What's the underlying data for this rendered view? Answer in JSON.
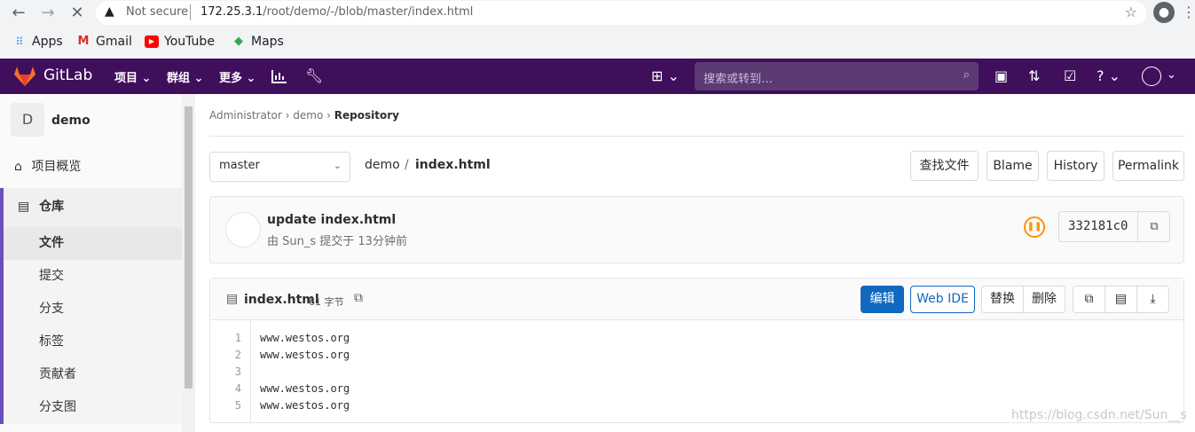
{
  "browser": {
    "not_secure": "Not secure",
    "url_host": "172.25.3.1",
    "url_path": "/root/demo/-/blob/master/index.html",
    "bookmarks": [
      {
        "label": "Apps",
        "icon": "apps-grid-icon"
      },
      {
        "label": "Gmail",
        "icon": "gmail-icon"
      },
      {
        "label": "YouTube",
        "icon": "youtube-icon"
      },
      {
        "label": "Maps",
        "icon": "maps-icon"
      }
    ]
  },
  "gitlab": {
    "logo_text": "GitLab",
    "nav": [
      "项目",
      "群组",
      "更多"
    ],
    "search_placeholder": "搜索或转到…",
    "colors": {
      "header": "#3f0f5c",
      "primary": "#1068bf",
      "pipeline": "#fc9403"
    }
  },
  "sidebar": {
    "avatar_letter": "D",
    "project_name": "demo",
    "overview": "项目概览",
    "repository": "仓库",
    "items": [
      "文件",
      "提交",
      "分支",
      "标签",
      "贡献者",
      "分支图"
    ]
  },
  "breadcrumb": {
    "items": [
      "Administrator",
      "demo"
    ],
    "current": "Repository"
  },
  "file_nav": {
    "branch": "master",
    "path_root": "demo",
    "path_sep": "/",
    "file": "index.html",
    "buttons": [
      "查找文件",
      "Blame",
      "History",
      "Permalink"
    ]
  },
  "commit": {
    "title": "update index.html",
    "meta": "由 Sun_s 提交于 13分钟前",
    "sha": "332181c0"
  },
  "file": {
    "name": "index.html",
    "size": "61 字节",
    "edit": "编辑",
    "web_ide": "Web IDE",
    "replace": "替换",
    "delete": "删除",
    "lines": [
      "www.westos.org",
      "www.westos.org",
      "",
      "www.westos.org",
      "www.westos.org"
    ],
    "line_numbers": [
      "1",
      "2",
      "3",
      "4",
      "5"
    ]
  },
  "watermark": "https://blog.csdn.net/Sun__s"
}
